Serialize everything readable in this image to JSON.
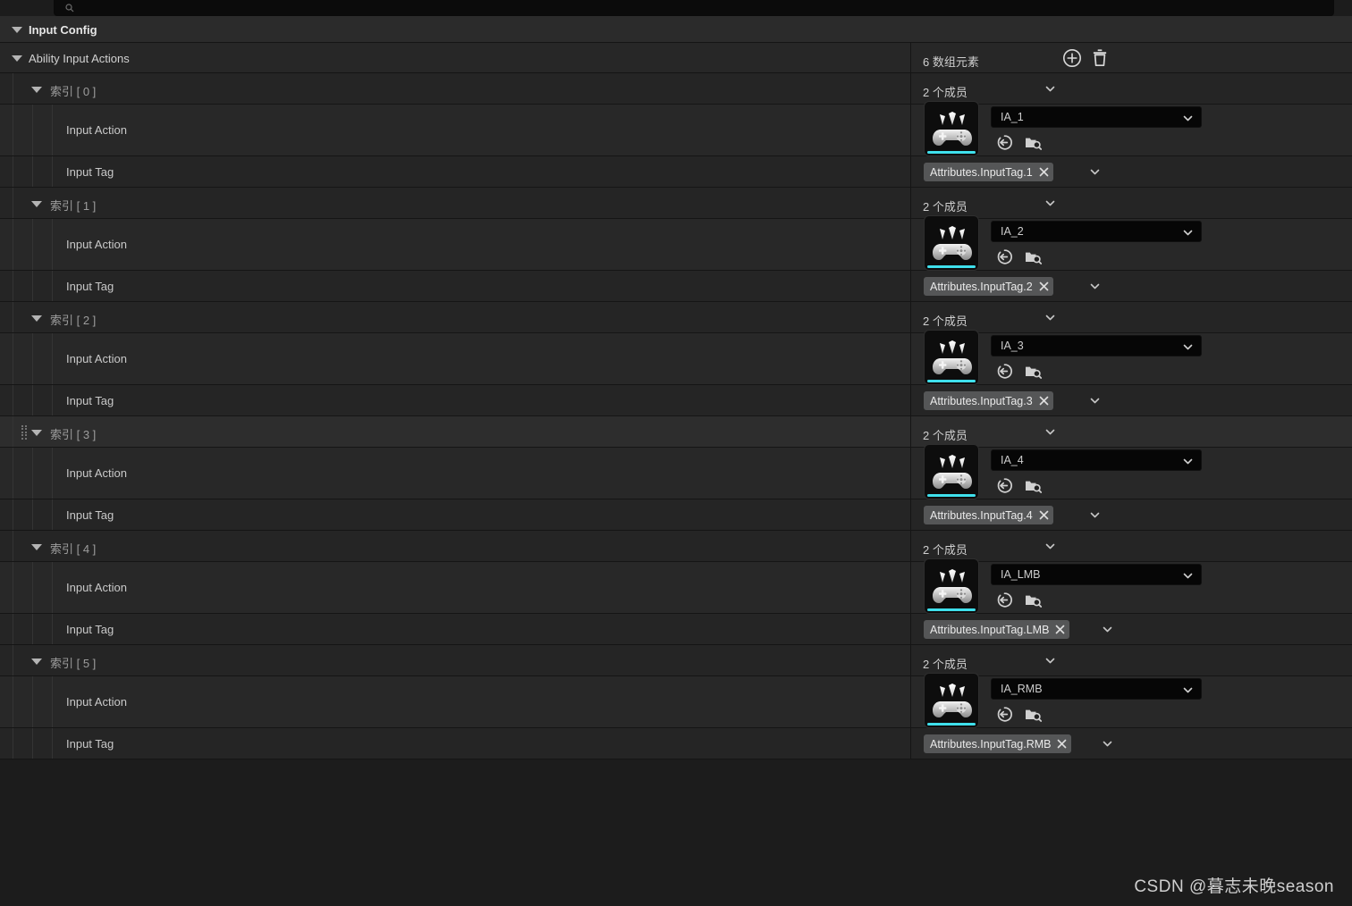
{
  "search": {
    "placeholder": "搜索"
  },
  "panel": {
    "category_label": "Input Config",
    "array_property_label": "Ability Input Actions",
    "array_count_label": "6 数组元素",
    "add_button_label": "添加元素",
    "delete_button_label": "删除所有元素",
    "members_label": "2 个成员",
    "input_action_label": "Input Action",
    "input_tag_label": "Input Tag",
    "browse_icon_label": "browse-to-asset",
    "find_icon_label": "find-in-content-browser"
  },
  "elements": [
    {
      "index_label": "索引 [ 0 ]",
      "members_label": "2 个成员",
      "input_action": "IA_1",
      "input_tag": "Attributes.InputTag.1",
      "hovered": false
    },
    {
      "index_label": "索引 [ 1 ]",
      "members_label": "2 个成员",
      "input_action": "IA_2",
      "input_tag": "Attributes.InputTag.2",
      "hovered": false
    },
    {
      "index_label": "索引 [ 2 ]",
      "members_label": "2 个成员",
      "input_action": "IA_3",
      "input_tag": "Attributes.InputTag.3",
      "hovered": false
    },
    {
      "index_label": "索引 [ 3 ]",
      "members_label": "2 个成员",
      "input_action": "IA_4",
      "input_tag": "Attributes.InputTag.4",
      "hovered": true
    },
    {
      "index_label": "索引 [ 4 ]",
      "members_label": "2 个成员",
      "input_action": "IA_LMB",
      "input_tag": "Attributes.InputTag.LMB",
      "hovered": false
    },
    {
      "index_label": "索引 [ 5 ]",
      "members_label": "2 个成员",
      "input_action": "IA_RMB",
      "input_tag": "Attributes.InputTag.RMB",
      "hovered": false
    }
  ],
  "watermark": "CSDN @暮志未晚season",
  "colors": {
    "accent_cyan": "#3fe0ec",
    "row_dark": "#232323",
    "row_darker": "#1f1f1f",
    "row_hover": "#2d2d2d",
    "divider": "#151515",
    "header_bg": "#2b2b2b"
  }
}
